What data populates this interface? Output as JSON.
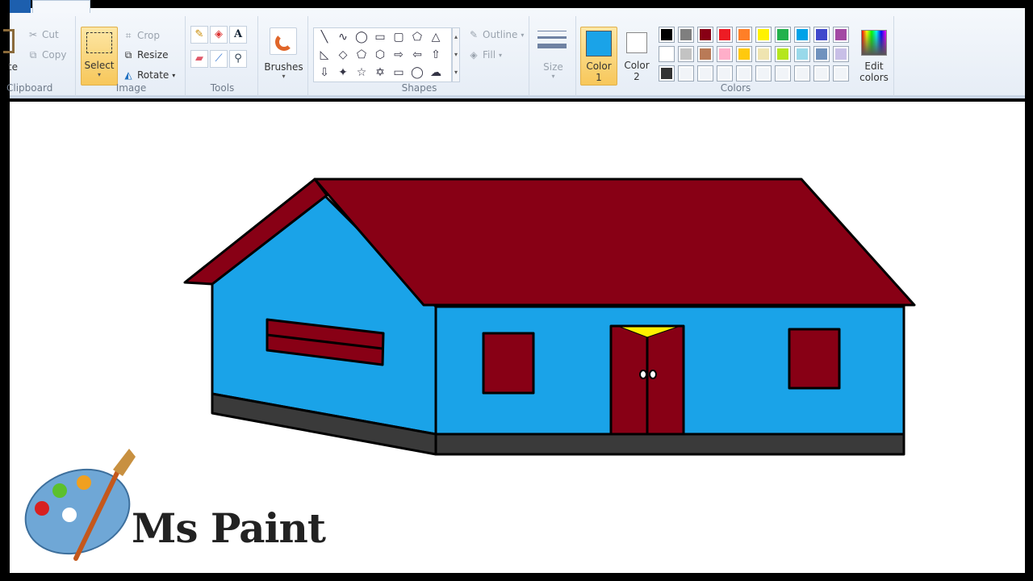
{
  "ribbon": {
    "clipboard": {
      "label": "Clipboard",
      "paste": "Paste",
      "cut": "Cut",
      "copy": "Copy"
    },
    "image": {
      "label": "Image",
      "select": "Select",
      "crop": "Crop",
      "resize": "Resize",
      "rotate": "Rotate"
    },
    "tools": {
      "label": "Tools",
      "items": [
        "pencil-icon",
        "fill-icon",
        "text-icon",
        "eraser-icon",
        "color-picker-icon",
        "magnifier-icon"
      ]
    },
    "brushes": {
      "label": "Brushes"
    },
    "shapes": {
      "label": "Shapes",
      "outline": "Outline",
      "fill": "Fill",
      "glyphs": [
        "╲",
        "∿",
        "◯",
        "▭",
        "▢",
        "⬠",
        "△",
        "◺",
        "◇",
        "⬠",
        "⬡",
        "⇨",
        "⇦",
        "⇧",
        "⇩",
        "✦",
        "☆",
        "✡",
        "▭",
        "◯",
        "☁"
      ]
    },
    "size": {
      "label": "Size"
    },
    "colors": {
      "label": "Colors",
      "color1": "Color",
      "color1_num": "1",
      "color2": "Color",
      "color2_num": "2",
      "color1_value": "#1aa3e8",
      "color2_value": "#ffffff",
      "edit": "Edit",
      "edit2": "colors",
      "palette": [
        "#000000",
        "#7f7f7f",
        "#880015",
        "#ed1c24",
        "#ff7f27",
        "#fff200",
        "#22b14c",
        "#00a2e8",
        "#3f48cc",
        "#a349a4",
        "#ffffff",
        "#c3c3c3",
        "#b97a57",
        "#ffaec9",
        "#ffc90e",
        "#efe4b0",
        "#b5e61d",
        "#99d9ea",
        "#7092be",
        "#c8bfe7",
        "#333333",
        "",
        "",
        "",
        "",
        "",
        "",
        "",
        "",
        ""
      ]
    }
  },
  "drawing": {
    "roof": "#880015",
    "wall": "#1aa3e8",
    "base": "#3a3a3a",
    "light": "#ffef00"
  },
  "logo": {
    "text": "Ms Paint"
  }
}
